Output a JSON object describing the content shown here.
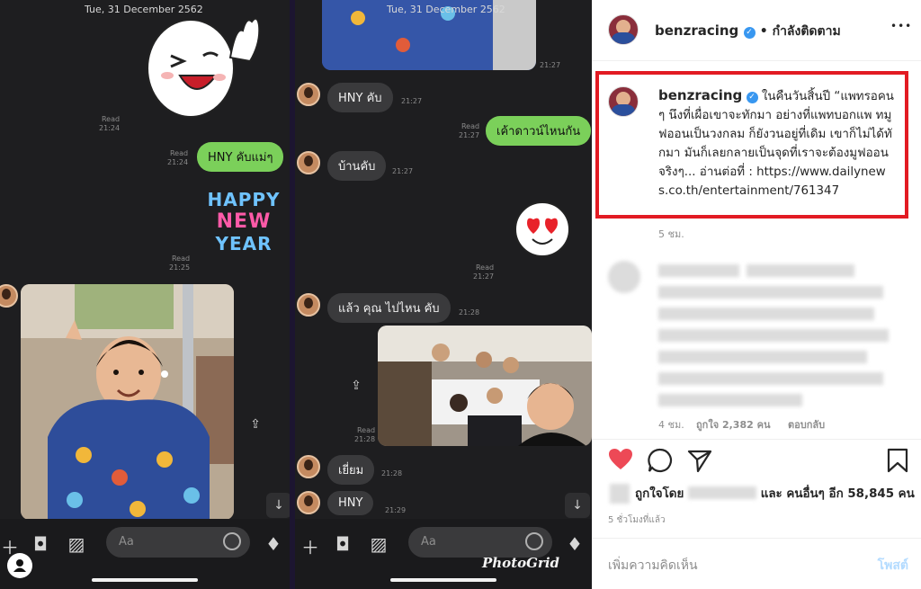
{
  "chat_left": {
    "date_header": "Tue, 31 December 2562",
    "msgs": {
      "read1": "Read",
      "time1": "21:24",
      "out1_read": "Read",
      "out1_time": "21:24",
      "out1_text": "HNY คับแม่ๆ",
      "sticker_text_1": "HAPPY",
      "sticker_text_2": "NEW",
      "sticker_text_3": "YEAR",
      "read2": "Read",
      "time2": "21:25"
    },
    "input_placeholder": "Aa"
  },
  "chat_right": {
    "date_header": "Tue, 31 December 2562",
    "msgs": {
      "photo_time": "21:27",
      "in1_text": "HNY คับ",
      "in1_time": "21:27",
      "out1_read": "Read",
      "out1_time": "21:27",
      "out1_text": "เค้าดาวน์ไหนกัน",
      "in2_text": "บ้านคับ",
      "in2_time": "21:27",
      "sticker_read": "Read",
      "sticker_time": "21:27",
      "in3_text": "แล้ว คุณ ไปไหน คับ",
      "in3_time": "21:28",
      "photo_read": "Read",
      "photo_read_time": "21:28",
      "in4_text": "เยี่ยม",
      "in4_time": "21:28",
      "in5_text": "HNY",
      "in5_time": "21:29"
    },
    "input_placeholder": "Aa",
    "watermark": "PhotoGrid"
  },
  "instagram": {
    "header": {
      "username": "benzracing",
      "following": "• กำลังติดตาม",
      "more": "•••"
    },
    "caption": {
      "username": "benzracing",
      "text": "ในคืนวันสิ้นปี “แพทรอคนๆ นึงที่เผื่อเขาจะทักมา อย่างที่แพทบอกแพ ทมูฟออนเป็นวงกลม ก็ยังวนอยู่ที่เดิม เขาก็ไม่ได้ทักมา มันก็เลยกลายเป็นจุดที่เราจะต้องมูฟออนจริงๆ... อ่านต่อที่ : https://www.dailynews.co.th/entertainment/761347",
      "time": "5 ชม."
    },
    "comment": {
      "time": "4 ชม.",
      "likes": "ถูกใจ 2,382 คน",
      "reply": "ตอบกลับ"
    },
    "likes_prefix": "ถูกใจโดย",
    "likes_suffix": "และ คนอื่นๆ อีก 58,845 คน",
    "post_time": "5 ชั่วโมงที่แล้ว",
    "comment_placeholder": "เพิ่มความคิดเห็น",
    "post_button": "โพสต์",
    "colors": {
      "like": "#ed4956",
      "link": "#b3dbff",
      "highlight": "#e21b23",
      "verified": "#3897f0"
    }
  }
}
